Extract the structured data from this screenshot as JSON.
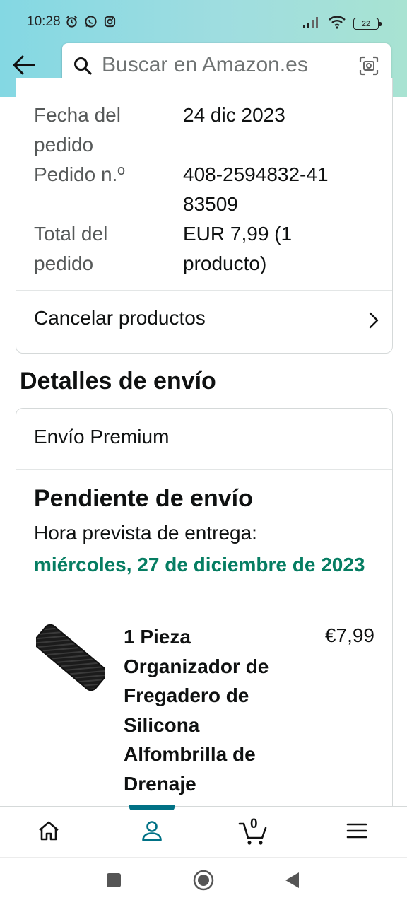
{
  "status_bar": {
    "time": "10:28",
    "battery": "22",
    "icons": [
      "alarm-icon",
      "whatsapp-icon",
      "instagram-icon",
      "signal-icon",
      "wifi-icon",
      "battery-icon"
    ]
  },
  "header": {
    "back_icon": "arrow-left-icon",
    "search_placeholder": "Buscar en Amazon.es",
    "search_icon": "search-icon",
    "camera_icon": "camera-scan-icon"
  },
  "order_info": {
    "date_label": "Fecha del pedido",
    "date_value": "24 dic 2023",
    "number_label": "Pedido n.º",
    "number_value": "408-2594832-4183509",
    "total_label": "Total del pedido",
    "total_value": "EUR 7,99 (1 producto)",
    "cancel_link": "Cancelar productos"
  },
  "shipping": {
    "section_title": "Detalles de envío",
    "type": "Envío Premium",
    "status": "Pendiente de envío",
    "eta_label": "Hora prevista de entrega:",
    "eta_date": "miércoles, 27 de diciembre de 2023",
    "product": {
      "name": "1 Pieza Organizador de Fregadero de Silicona Alfombrilla de Drenaje",
      "price": "€7,99"
    }
  },
  "bottom_nav": {
    "items": [
      "home-icon",
      "account-icon",
      "cart-icon",
      "menu-icon"
    ],
    "active": "account-icon",
    "cart_count": "0",
    "accent": "#007185"
  },
  "colors": {
    "eta_green": "#067d62",
    "header_gradient_start": "#84d8e3",
    "header_gradient_end": "#a8e3d2"
  }
}
